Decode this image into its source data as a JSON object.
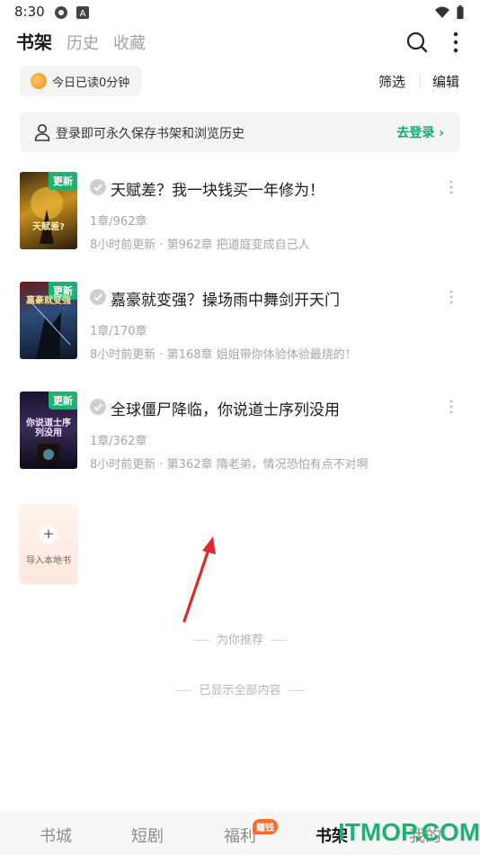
{
  "status_bar": {
    "time": "8:30"
  },
  "top_tabs": [
    {
      "label": "书架",
      "active": true
    },
    {
      "label": "历史",
      "active": false
    },
    {
      "label": "收藏",
      "active": false
    }
  ],
  "reading_chip": {
    "label": "今日已读0分钟"
  },
  "actions": {
    "filter": "筛选",
    "edit": "编辑"
  },
  "login_banner": {
    "message": "登录即可永久保存书架和浏览历史",
    "link": "去登录 ›"
  },
  "books": [
    {
      "tag": "更新",
      "cover_title": "天赋差?",
      "title": "天赋差？我一块钱买一年修为！",
      "progress": "1章/962章",
      "update": "8小时前更新 · 第962章 把道庭变成自己人"
    },
    {
      "tag": "更新",
      "cover_title": "嘉豪就变强",
      "title": "嘉豪就变强？操场雨中舞剑开天门",
      "progress": "1章/170章",
      "update": "8小时前更新 · 第168章 姐姐带你体验体验最烧的！"
    },
    {
      "tag": "更新",
      "cover_title": "你说道士序列没用",
      "title": "全球僵尸降临，你说道士序列没用",
      "progress": "1章/362章",
      "update": "8小时前更新 · 第362章 隋老弟，情况恐怕有点不对啊"
    }
  ],
  "import_card": {
    "plus": "+",
    "label": "导入本地书"
  },
  "recommend_divider": "为你推荐",
  "end_divider": "已显示全部内容",
  "bottom_nav": [
    {
      "label": "书城",
      "active": false
    },
    {
      "label": "短剧",
      "active": false
    },
    {
      "label": "福利",
      "active": false
    },
    {
      "label": "书架",
      "active": true
    },
    {
      "label": "我的",
      "active": false
    }
  ],
  "earn_badge": "赚钱",
  "watermark": "ITMOP.COM",
  "colors": {
    "accent_green": "#17a86c",
    "update_tag": "#1fb174",
    "badge_orange": "#ff6a2b",
    "arrow_red": "#e02a2a"
  }
}
